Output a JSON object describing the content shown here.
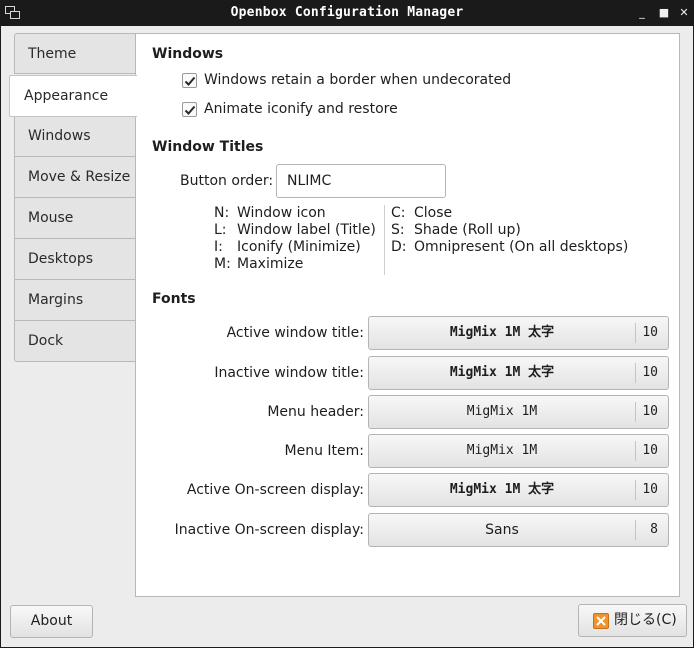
{
  "window": {
    "title": "Openbox Configuration Manager",
    "controls": {
      "minimize": "_",
      "maximize": "■",
      "close": "✕"
    }
  },
  "tabs": [
    {
      "label": "Theme",
      "active": false
    },
    {
      "label": "Appearance",
      "active": true
    },
    {
      "label": "Windows",
      "active": false
    },
    {
      "label": "Move & Resize",
      "active": false
    },
    {
      "label": "Mouse",
      "active": false
    },
    {
      "label": "Desktops",
      "active": false
    },
    {
      "label": "Margins",
      "active": false
    },
    {
      "label": "Dock",
      "active": false
    }
  ],
  "windows_section": {
    "title": "Windows",
    "options": [
      {
        "label": "Windows retain a border when undecorated",
        "checked": true
      },
      {
        "label": "Animate iconify and restore",
        "checked": true
      }
    ]
  },
  "window_titles": {
    "title": "Window Titles",
    "button_order_label": "Button order:",
    "button_order_value": "NLIMC",
    "legend_left": [
      {
        "key": "N:",
        "desc": "Window icon"
      },
      {
        "key": "L:",
        "desc": "Window label (Title)"
      },
      {
        "key": "I:",
        "desc": "Iconify (Minimize)"
      },
      {
        "key": "M:",
        "desc": "Maximize"
      }
    ],
    "legend_right": [
      {
        "key": "C:",
        "desc": "Close"
      },
      {
        "key": "S:",
        "desc": "Shade (Roll up)"
      },
      {
        "key": "D:",
        "desc": "Omnipresent (On all desktops)"
      }
    ]
  },
  "fonts": {
    "title": "Fonts",
    "rows": [
      {
        "label": "Active window title:",
        "font": "MigMix 1M 太字",
        "size": "10",
        "bold": true
      },
      {
        "label": "Inactive window title:",
        "font": "MigMix 1M 太字",
        "size": "10",
        "bold": true
      },
      {
        "label": "Menu header:",
        "font": "MigMix 1M",
        "size": "10",
        "bold": false
      },
      {
        "label": "Menu Item:",
        "font": "MigMix 1M",
        "size": "10",
        "bold": false
      },
      {
        "label": "Active On-screen display:",
        "font": "MigMix 1M 太字",
        "size": "10",
        "bold": true
      },
      {
        "label": "Inactive On-screen display:",
        "font": "Sans",
        "size": "8",
        "bold": false
      }
    ]
  },
  "footer": {
    "about_label": "About",
    "close_label": "閉じる(C)",
    "close_icon_color": "#f0932b"
  },
  "icons": {
    "check": "check-icon",
    "close": "close-icon",
    "app": "app-icon"
  }
}
